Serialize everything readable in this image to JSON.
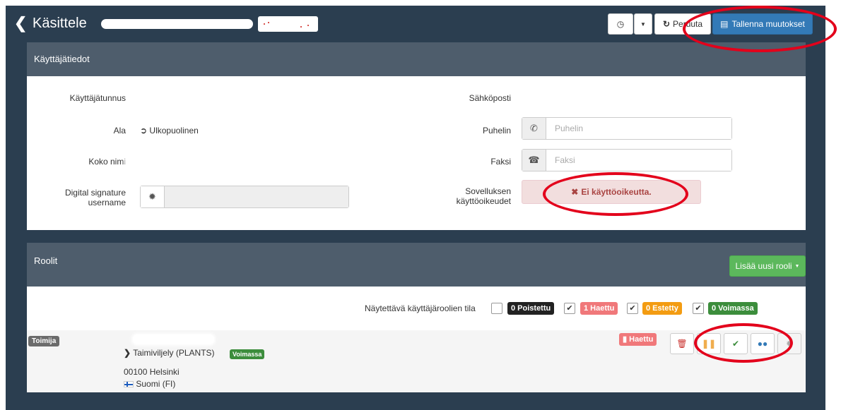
{
  "header": {
    "back_icon": "chevron-left-icon",
    "title": "Käsittele",
    "history_icon": "clock-icon",
    "dropdown_icon": "caret-down-icon",
    "cancel_label": "Peruuta",
    "cancel_icon": "refresh-icon",
    "save_label": "Tallenna muutokset",
    "save_icon": "save-icon"
  },
  "user_panel": {
    "title": "Käyttäjätiedot",
    "username_label": "Käyttäjätunnus",
    "area_label": "Ala",
    "area_value": "Ulkopuolinen",
    "area_icon": "sign-out-icon",
    "fullname_label": "Koko nimi",
    "signature_label_1": "Digital signature",
    "signature_label_2": "username",
    "signature_icon": "certificate-icon",
    "email_label": "Sähköposti",
    "phone_label": "Puhelin",
    "phone_placeholder": "Puhelin",
    "phone_icon": "phone-icon",
    "fax_label": "Faksi",
    "fax_placeholder": "Faksi",
    "fax_icon": "fax-icon",
    "rights_label_1": "Sovelluksen",
    "rights_label_2": "käyttöoikeudet",
    "rights_value": "Ei käyttöoikeutta.",
    "rights_icon": "times-icon"
  },
  "roles_panel": {
    "title": "Roolit",
    "add_role_label": "Lisää uusi rooli",
    "filter_label": "Näytettävä käyttäjäroolien tila",
    "filters": [
      {
        "label": "0 Poistettu",
        "checked": false,
        "color": "#222222"
      },
      {
        "label": "1 Haettu",
        "checked": true,
        "color": "#f0787a"
      },
      {
        "label": "0 Estetty",
        "checked": true,
        "color": "#f39c12"
      },
      {
        "label": "0 Voimassa",
        "checked": true,
        "color": "#3c8d3c"
      }
    ],
    "role": {
      "type_badge": "Toimija",
      "org_name": "Taimiviljely (PLANTS)",
      "org_status": "Voimassa",
      "address": "00100 Helsinki",
      "country": "Suomi (FI)",
      "country_icon": "finland-flag-icon",
      "status_badge": "Haettu",
      "status_icon": "comment-icon",
      "actions": [
        "trash-icon",
        "pause-icon",
        "check-icon",
        "users-icon",
        "certificate-icon"
      ]
    }
  },
  "colors": {
    "background": "#2b3e50",
    "panel_header": "#4e5d6c",
    "primary": "#337ab7",
    "success": "#5cb85c",
    "annotation": "#e3001b"
  }
}
